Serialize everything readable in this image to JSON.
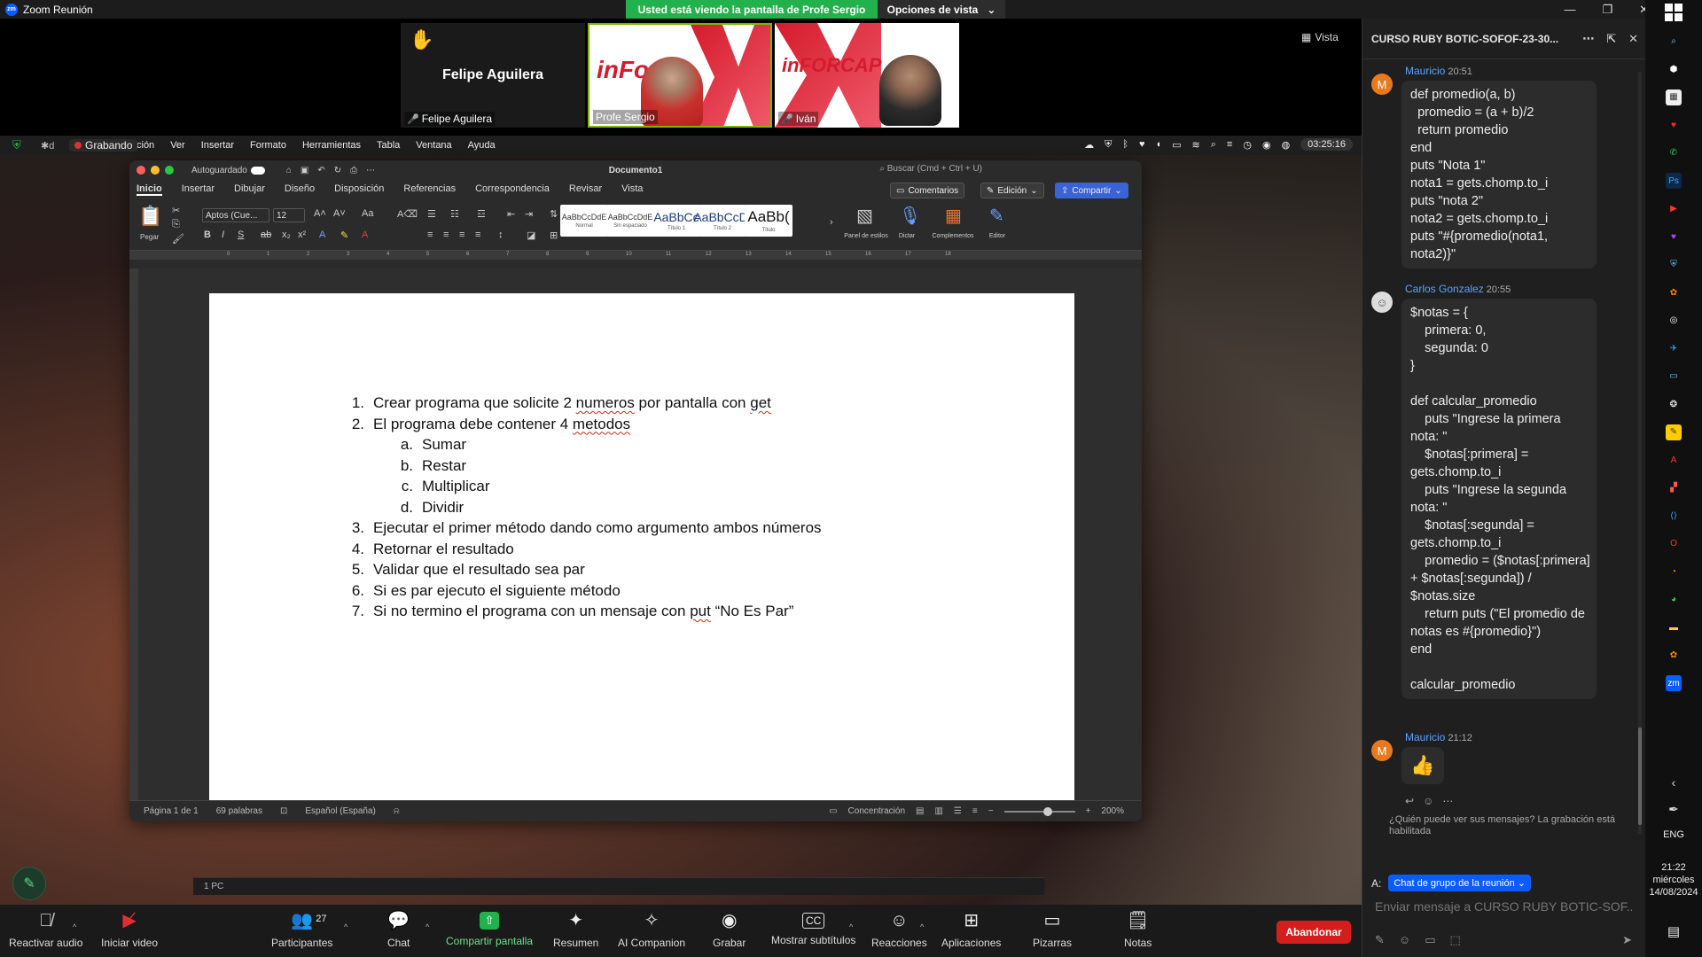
{
  "app": {
    "title": "Zoom Reunión"
  },
  "banner": {
    "sharing": "Usted está viendo la pantalla de Profe Sergio",
    "view_options": "Opciones de vista"
  },
  "participants": [
    {
      "name": "Felipe Aguilera",
      "display_name": "Felipe Aguilera"
    },
    {
      "name": "Profe Sergio",
      "brand": "inFor"
    },
    {
      "name": "Iván",
      "brand": "inFORCAP"
    }
  ],
  "vista_label": "Vista",
  "mac_menu": {
    "recording": "Grabando",
    "items": [
      "ción",
      "Ver",
      "Insertar",
      "Formato",
      "Herramientas",
      "Tabla",
      "Ventana",
      "Ayuda"
    ],
    "clock": "03:25:16"
  },
  "word": {
    "autosave": "Autoguardado",
    "doc_title": "Documento1",
    "search": "Buscar (Cmd + Ctrl + U)",
    "tabs": [
      "Inicio",
      "Insertar",
      "Dibujar",
      "Diseño",
      "Disposición",
      "Referencias",
      "Correspondencia",
      "Revisar",
      "Vista"
    ],
    "buttons": {
      "comments": "Comentarios",
      "editing": "Edición",
      "share": "Compartir"
    },
    "font_name": "Aptos (Cue...",
    "font_size": "12",
    "paste": "Pegar",
    "styles": [
      {
        "sample": "AaBbCcDdE",
        "name": "Normal"
      },
      {
        "sample": "AaBbCcDdE",
        "name": "Sin espaciado"
      },
      {
        "sample": "AaBbCc",
        "name": "Título 1"
      },
      {
        "sample": "AaBbCcDı",
        "name": "Título 2"
      },
      {
        "sample": "AaBb(",
        "name": "Título"
      }
    ],
    "ribbon_right": [
      "Panel de estilos",
      "Dictar",
      "Complementos",
      "Editor"
    ],
    "list": [
      {
        "n": "1.",
        "pre": "Crear programa que solicite 2 ",
        "err": "numeros",
        "post": " por pantalla con ",
        "err2": "get"
      },
      {
        "n": "2.",
        "pre": "El programa debe contener 4 ",
        "err": "metodos",
        "post": "",
        "err2": ""
      },
      {
        "n": "a.",
        "pre": "Sumar",
        "sub": true
      },
      {
        "n": "b.",
        "pre": "Restar",
        "sub": true
      },
      {
        "n": "c.",
        "pre": "Multiplicar",
        "sub": true
      },
      {
        "n": "d.",
        "pre": "Dividir",
        "sub": true
      },
      {
        "n": "3.",
        "pre": "Ejecutar el primer método dando como argumento ambos números"
      },
      {
        "n": "4.",
        "pre": "Retornar el resultado"
      },
      {
        "n": "5.",
        "pre": "Validar que el resultado sea par"
      },
      {
        "n": "6.",
        "pre": "Si es par ejecuto el siguiente método"
      },
      {
        "n": "7.",
        "pre": "Si no termino el programa con un mensaje con ",
        "err": "put",
        "post": " “No Es Par”"
      }
    ],
    "status": {
      "page": "Página 1 de 1",
      "words": "69 palabras",
      "lang": "Español (España)",
      "focus": "Concentración",
      "zoom": "200%"
    }
  },
  "pc_label": "1 PC",
  "toolbar": {
    "unmute": "Reactivar audio",
    "start_video": "Iniciar video",
    "participants": "Participantes",
    "participants_count": "27",
    "chat": "Chat",
    "share": "Compartir pantalla",
    "summary": "Resumen",
    "ai": "AI Companion",
    "record": "Grabar",
    "captions": "Mostrar subtítulos",
    "reactions": "Reacciones",
    "apps": "Aplicaciones",
    "whiteboards": "Pizarras",
    "notes": "Notas",
    "leave": "Abandonar"
  },
  "chat": {
    "title": "CURSO RUBY BOTIC-SOFOF-23-30...",
    "messages": [
      {
        "author": "Mauricio",
        "time": "20:51",
        "avatar": "M",
        "text": "def promedio(a, b)\n  promedio = (a + b)/2\n  return promedio\nend\nputs \"Nota 1\"\nnota1 = gets.chomp.to_i\nputs \"nota 2\"\nnota2 = gets.chomp.to_i\nputs \"#{promedio(nota1, nota2)}\""
      },
      {
        "author": "Carlos Gonzalez",
        "time": "20:55",
        "text": "$notas = {\n    primera: 0,\n    segunda: 0\n}\n\ndef calcular_promedio\n    puts \"Ingrese la primera nota: \"\n    $notas[:primera] = gets.chomp.to_i\n    puts \"Ingrese la segunda nota: \"\n    $notas[:segunda] = gets.chomp.to_i\n    promedio = ($notas[:primera] + $notas[:segunda]) / $notas.size\n    return puts (\"El promedio de notas es #{promedio}\")\nend\n\ncalcular_promedio"
      },
      {
        "author": "Mauricio",
        "time": "21:12",
        "avatar": "M",
        "text": "👍"
      }
    ],
    "privacy": "¿Quién puede ver sus mensajes? La grabación está habilitada",
    "to_label": "A:",
    "to_target": "Chat de grupo de la reunión",
    "input_placeholder": "Enviar mensaje a CURSO RUBY BOTIC-SOF..."
  },
  "taskbar": {
    "lang": "ENG",
    "time": "21:22",
    "day": "miércoles",
    "date": "14/08/2024"
  },
  "colors": {
    "share_green": "#23b14d",
    "zoom_blue": "#0b5cff",
    "leave_red": "#d41e1e"
  }
}
